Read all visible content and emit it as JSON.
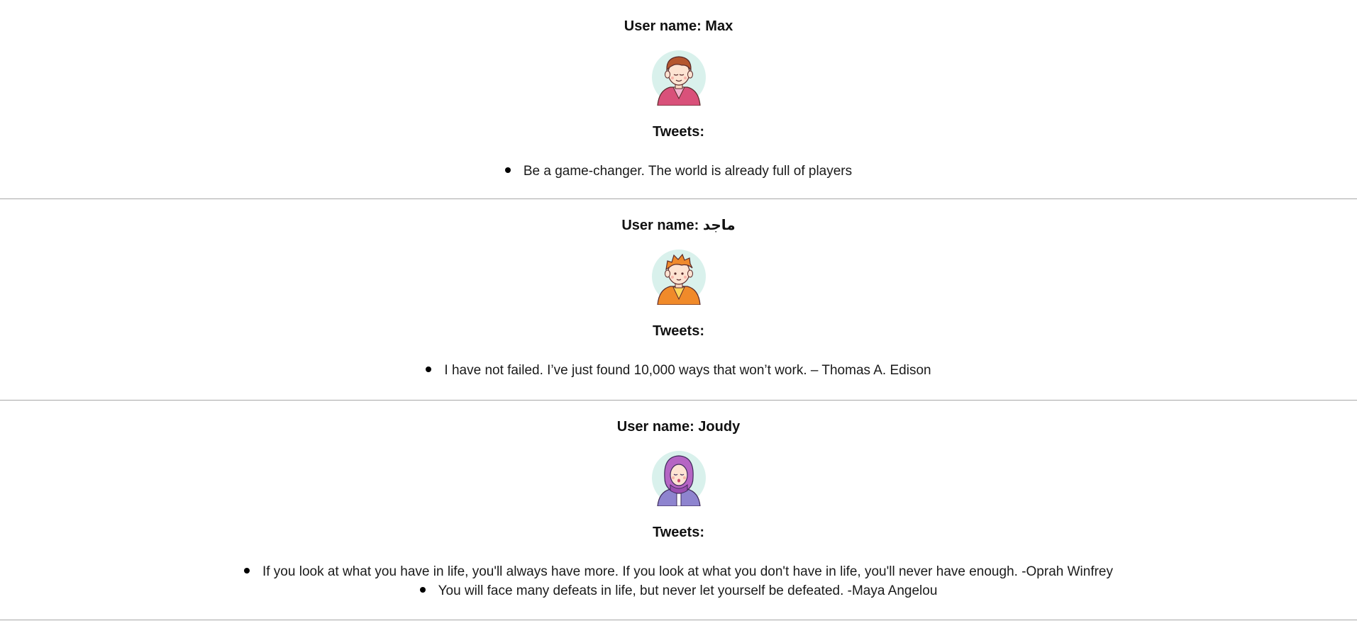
{
  "users": [
    {
      "name_label": "User name: Max",
      "avatar_icon": "boy-brown-hair-pink-jacket-avatar",
      "colors": {
        "bg": "#d9f1ec",
        "hair": "#b4562f",
        "jacket": "#d9517a",
        "shirt": "#f4b3cf"
      },
      "tweets_label": "Tweets:",
      "tweets": [
        "Be a game-changer. The world is already full of players"
      ]
    },
    {
      "name_label": "User name: ماجد",
      "avatar_icon": "boy-orange-hair-orange-jacket-avatar",
      "colors": {
        "bg": "#d9f1ec",
        "hair": "#ef8a2c",
        "jacket": "#f08a2a",
        "shirt": "#ffd65a"
      },
      "tweets_label": "Tweets:",
      "tweets": [
        "I have not failed. I’ve just found 10,000 ways that won’t work. – Thomas A. Edison"
      ]
    },
    {
      "name_label": "User name: Joudy",
      "avatar_icon": "girl-purple-hijab-avatar",
      "colors": {
        "bg": "#d9f1ec",
        "hijab": "#b565c4",
        "jacket": "#8e84cf",
        "shirt": "#ffffff"
      },
      "tweets_label": "Tweets:",
      "tweets": [
        "If you look at what you have in life, you'll always have more. If you look at what you don't have in life, you'll never have enough. -Oprah Winfrey",
        "You will face many defeats in life, but never let yourself be defeated. -Maya Angelou"
      ]
    }
  ]
}
